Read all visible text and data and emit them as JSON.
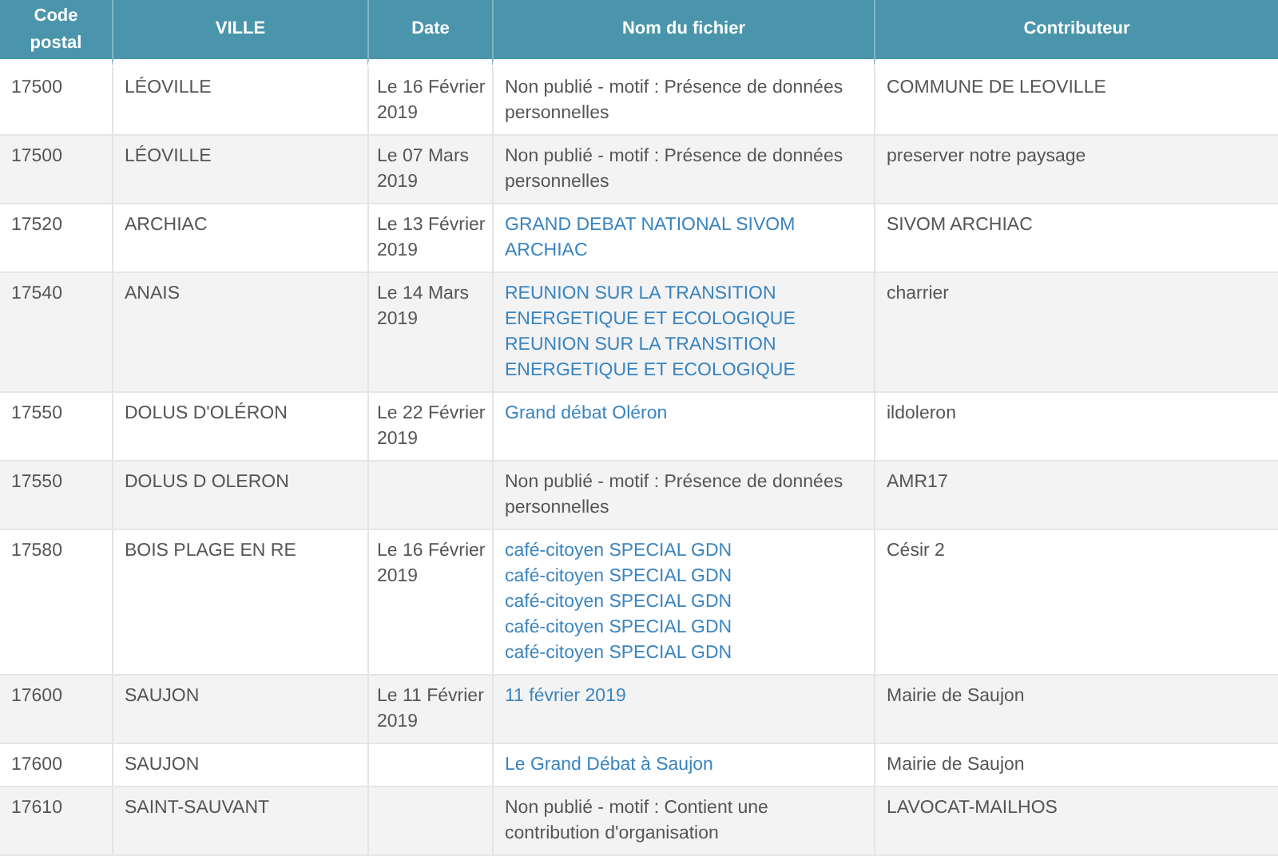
{
  "table": {
    "columns": [
      "Code postal",
      "VILLE",
      "Date",
      "Nom du fichier",
      "Contributeur"
    ],
    "rows": [
      {
        "code": "17500",
        "ville": "LÉOVILLE",
        "date": "Le 16 Février 2019",
        "fichier": [
          {
            "kind": "text",
            "text": "Non publié - motif : Présence de données personnelles"
          }
        ],
        "contributeur": "COMMUNE DE LEOVILLE"
      },
      {
        "code": "17500",
        "ville": "LÉOVILLE",
        "date": "Le 07 Mars 2019",
        "fichier": [
          {
            "kind": "text",
            "text": "Non publié - motif : Présence de données personnelles"
          }
        ],
        "contributeur": "preserver notre paysage"
      },
      {
        "code": "17520",
        "ville": "ARCHIAC",
        "date": "Le 13 Février 2019",
        "fichier": [
          {
            "kind": "link",
            "text": "GRAND DEBAT NATIONAL SIVOM ARCHIAC"
          }
        ],
        "contributeur": "SIVOM ARCHIAC"
      },
      {
        "code": "17540",
        "ville": "ANAIS",
        "date": "Le 14 Mars 2019",
        "fichier": [
          {
            "kind": "link",
            "text": "REUNION SUR LA TRANSITION ENERGETIQUE ET ECOLOGIQUE"
          },
          {
            "kind": "link",
            "text": "REUNION SUR LA TRANSITION ENERGETIQUE ET ECOLOGIQUE"
          }
        ],
        "contributeur": "charrier"
      },
      {
        "code": "17550",
        "ville": "DOLUS D'OLÉRON",
        "date": "Le 22 Février 2019",
        "fichier": [
          {
            "kind": "link",
            "text": "Grand débat Oléron"
          }
        ],
        "contributeur": "ildoleron"
      },
      {
        "code": "17550",
        "ville": "DOLUS D OLERON",
        "fichier": [
          {
            "kind": "text",
            "text": "Non publié - motif : Présence de données personnelles"
          }
        ],
        "contributeur": "AMR17"
      },
      {
        "code": "17580",
        "ville": "BOIS PLAGE EN RE",
        "date": "Le 16 Février 2019",
        "fichier": [
          {
            "kind": "link",
            "text": "café-citoyen SPECIAL GDN"
          },
          {
            "kind": "link",
            "text": "café-citoyen SPECIAL GDN"
          },
          {
            "kind": "link",
            "text": "café-citoyen SPECIAL GDN"
          },
          {
            "kind": "link",
            "text": "café-citoyen SPECIAL GDN"
          },
          {
            "kind": "link",
            "text": "café-citoyen SPECIAL GDN"
          }
        ],
        "contributeur": "Césir 2"
      },
      {
        "code": "17600",
        "ville": "SAUJON",
        "date": "Le 11 Février 2019",
        "fichier": [
          {
            "kind": "link",
            "text": "11 février 2019"
          }
        ],
        "contributeur": "Mairie de Saujon"
      },
      {
        "code": "17600",
        "ville": "SAUJON",
        "fichier": [
          {
            "kind": "link",
            "text": "Le Grand Débat à Saujon"
          }
        ],
        "contributeur": "Mairie de Saujon"
      },
      {
        "code": "17610",
        "ville": "SAINT-SAUVANT",
        "fichier": [
          {
            "kind": "text",
            "text": "Non publié - motif : Contient une contribution d'organisation"
          }
        ],
        "contributeur": "LAVOCAT-MAILHOS"
      }
    ]
  }
}
